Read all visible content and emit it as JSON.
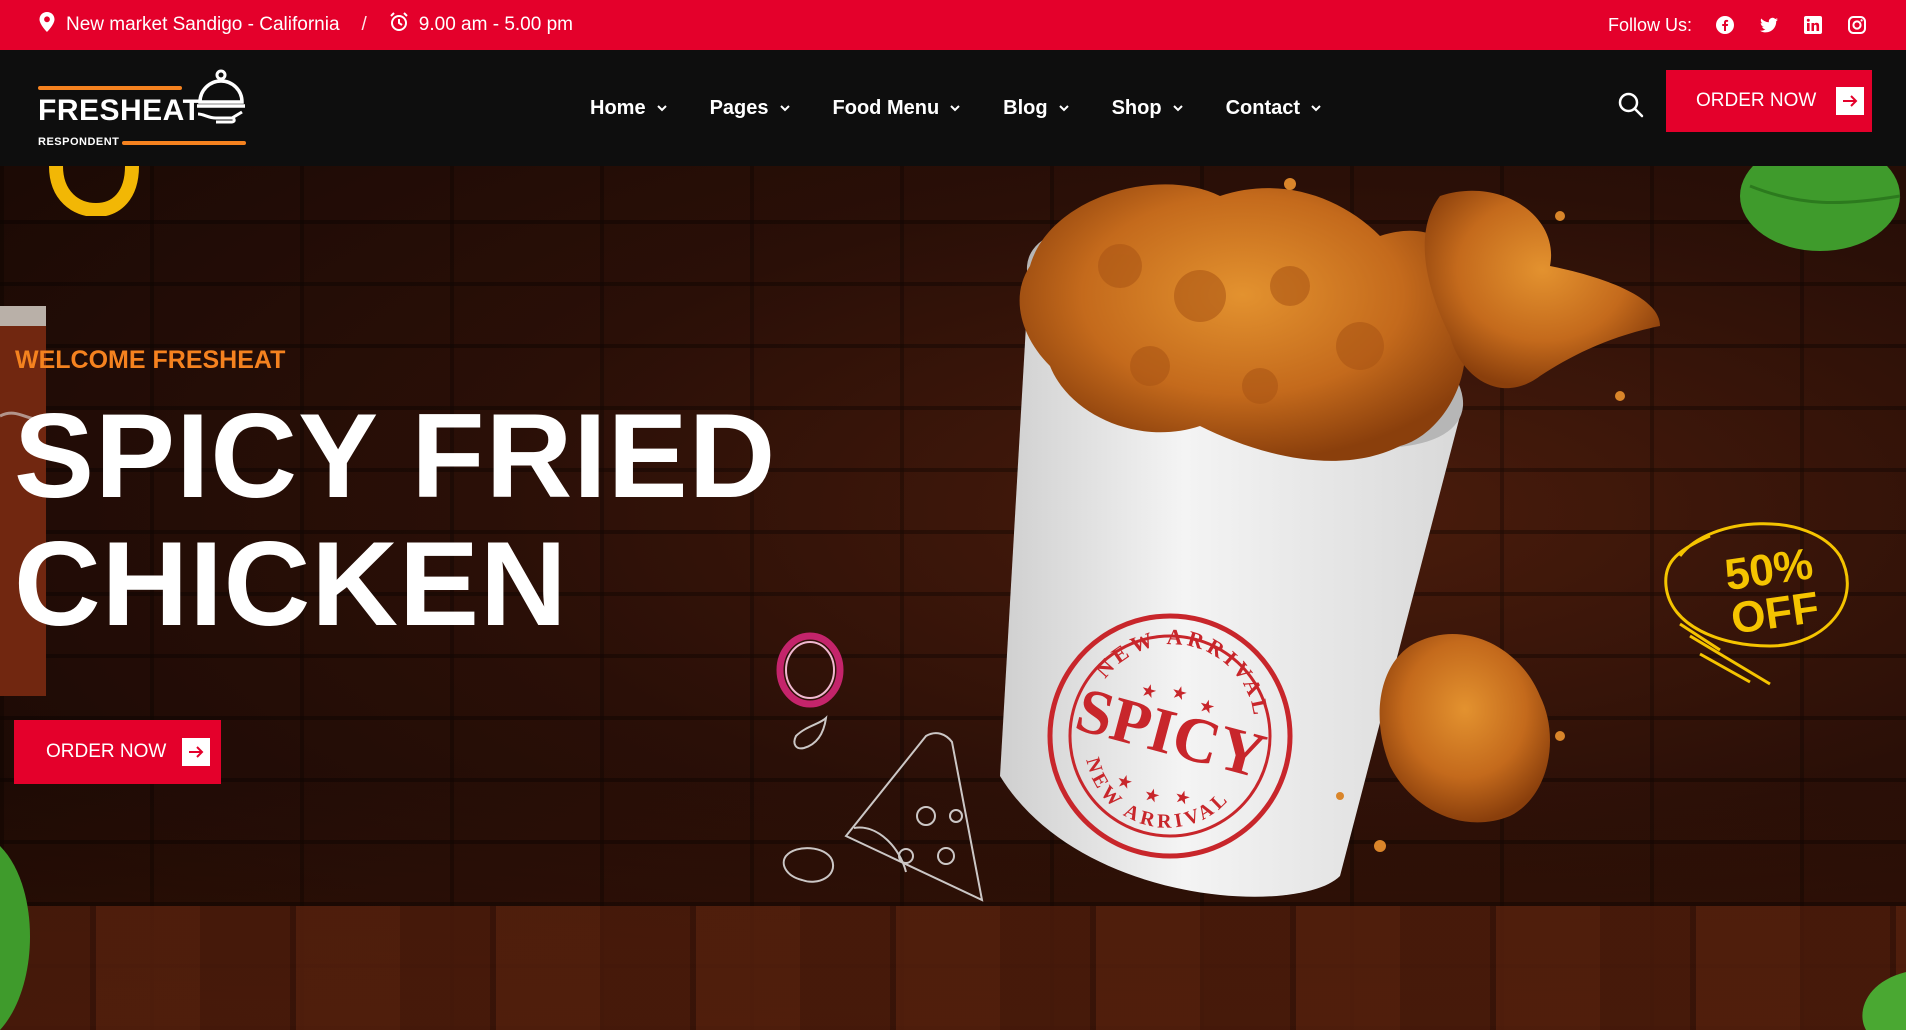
{
  "topbar": {
    "location": "New market Sandigo - California",
    "separator": "/",
    "hours": "9.00 am - 5.00 pm",
    "follow_label": "Follow Us:",
    "socials": [
      "facebook-icon",
      "twitter-icon",
      "linkedin-icon",
      "instagram-icon"
    ]
  },
  "logo": {
    "name": "FRESHEAT",
    "tagline": "RESPONDENT"
  },
  "nav": {
    "items": [
      {
        "label": "Home"
      },
      {
        "label": "Pages"
      },
      {
        "label": "Food Menu"
      },
      {
        "label": "Blog"
      },
      {
        "label": "Shop"
      },
      {
        "label": "Contact"
      }
    ],
    "order_label": "ORDER NOW"
  },
  "hero": {
    "eyebrow": "WELCOME FRESHEAT",
    "title_line1": "SPICY FRIED",
    "title_line2": "CHICKEN",
    "order_label": "ORDER NOW",
    "stamp_top": "NEW ARRIVAL",
    "stamp_center": "SPICY",
    "stamp_bottom": "NEW ARRIVAL",
    "discount_line1": "50%",
    "discount_line2": "OFF"
  },
  "colors": {
    "brand_red": "#e4002b",
    "accent_orange": "#f5821f",
    "nav_bg": "#0e0e0e",
    "discount_yellow": "#f5c400"
  }
}
